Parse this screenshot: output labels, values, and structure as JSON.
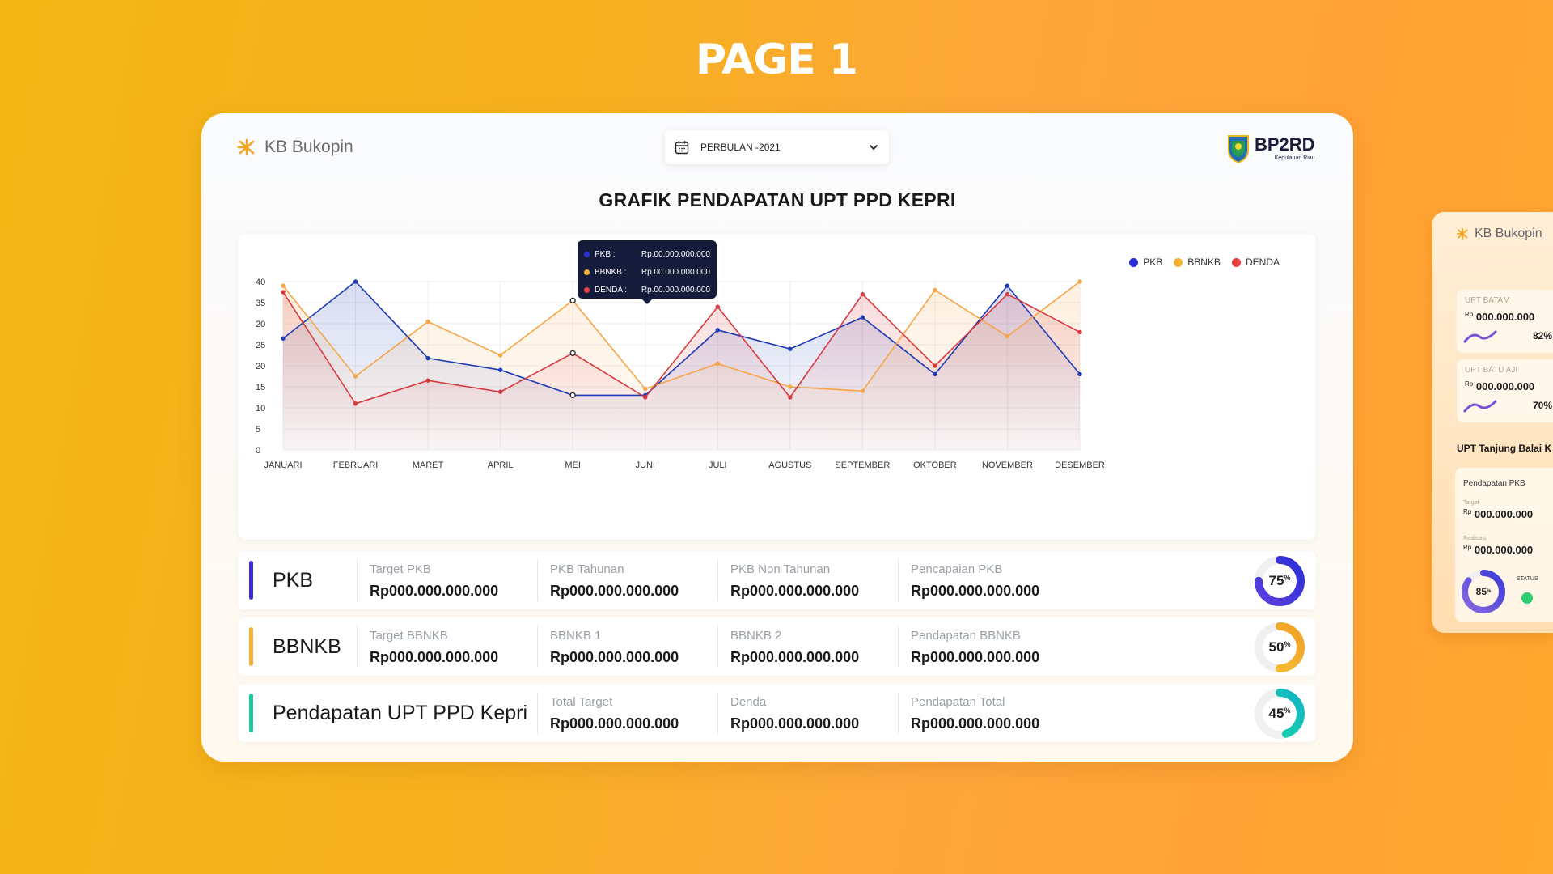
{
  "page": {
    "title": "PAGE 1"
  },
  "brand": {
    "kb_text": "KB Bukopin",
    "bp_text": "BP2RD",
    "bp_sub": "Kepulauan Riau"
  },
  "filter": {
    "period": "PERBULAN -2021"
  },
  "chart_title": "GRAFIK PENDAPATAN UPT PPD KEPRI",
  "legend": [
    {
      "name": "PKB",
      "color": "#2b2fd6"
    },
    {
      "name": "BBNKB",
      "color": "#f2b233"
    },
    {
      "name": "DENDA",
      "color": "#e8403f"
    }
  ],
  "tooltip": {
    "rows": [
      {
        "label": "PKB :",
        "value": "Rp.00.000.000.000",
        "color": "#2b2fd6"
      },
      {
        "label": "BBNKB :",
        "value": "Rp.00.000.000.000",
        "color": "#f2b233"
      },
      {
        "label": "DENDA :",
        "value": "Rp.00.000.000.000",
        "color": "#e8403f"
      }
    ]
  },
  "chart_data": {
    "type": "area",
    "categories": [
      "JANUARI",
      "FEBRUARI",
      "MARET",
      "APRIL",
      "MEI",
      "JUNI",
      "JULI",
      "AGUSTUS",
      "SEPTEMBER",
      "OKTOBER",
      "NOVEMBER",
      "DESEMBER"
    ],
    "y_ticks": [
      "40",
      "35",
      "20",
      "25",
      "20",
      "15",
      "10",
      "5",
      "0"
    ],
    "ylim": [
      0,
      40
    ],
    "grid": true,
    "legend_position": "top-right",
    "series": [
      {
        "name": "PKB",
        "color": "#1c3bb5",
        "values": [
          26.5,
          40,
          21.8,
          19,
          13,
          13,
          28.5,
          24,
          31.5,
          18,
          39,
          18
        ]
      },
      {
        "name": "BBNKB",
        "color": "#f5a547",
        "values": [
          39,
          17.5,
          30.5,
          22.5,
          35.5,
          14.5,
          20.5,
          15,
          14,
          38,
          27,
          40
        ]
      },
      {
        "name": "DENDA",
        "color": "#d9393d",
        "values": [
          37.5,
          11,
          16.5,
          13.8,
          23,
          12.5,
          34,
          12.5,
          37,
          20,
          37,
          28
        ]
      }
    ]
  },
  "stats": [
    {
      "name": "PKB",
      "color": "#3a2fd1",
      "donut_color": "#5b3fe0",
      "donut_color2": "#2b2fd6",
      "percent": 75,
      "cols": [
        {
          "label": "Target PKB",
          "value": "Rp000.000.000.000"
        },
        {
          "label": "PKB Tahunan",
          "value": "Rp000.000.000.000"
        },
        {
          "label": "PKB Non Tahunan",
          "value": "Rp000.000.000.000"
        },
        {
          "label": "Pencapaian PKB",
          "value": "Rp000.000.000.000"
        }
      ]
    },
    {
      "name": "BBNKB",
      "color": "#f2b233",
      "donut_color": "#f5c531",
      "donut_color2": "#f29f2a",
      "percent": 50,
      "cols": [
        {
          "label": "Target BBNKB",
          "value": "Rp000.000.000.000"
        },
        {
          "label": "BBNKB 1",
          "value": "Rp000.000.000.000"
        },
        {
          "label": "BBNKB 2",
          "value": "Rp000.000.000.000"
        },
        {
          "label": "Pendapatan BBNKB",
          "value": "Rp000.000.000.000"
        }
      ]
    },
    {
      "name": "Pendapatan UPT PPD Kepri",
      "color": "#1ec9a0",
      "donut_color": "#1ed6a4",
      "donut_color2": "#12b5c4",
      "percent": 45,
      "cols": [
        {
          "label": "Total Target",
          "value": "Rp000.000.000.000"
        },
        {
          "label": "Denda",
          "value": "Rp000.000.000.000"
        },
        {
          "label": "Pendapatan Total",
          "value": "Rp000.000.000.000"
        }
      ]
    }
  ],
  "side": {
    "logo": "KB Bukopin",
    "minis": [
      {
        "title": "UPT BATAM",
        "rp": "Rp",
        "amount": "000.000.000",
        "percent": "82%"
      },
      {
        "title": "UPT BATU AJI",
        "rp": "Rp",
        "amount": "000.000.000",
        "percent": "70%"
      }
    ],
    "section": "UPT Tanjung Balai K",
    "box": {
      "heading": "Pendapatan PKB",
      "target_label": "Target",
      "target_rp": "Rp",
      "target_value": "000.000.000",
      "real_label": "Realisasi",
      "real_rp": "Rp",
      "real_value": "000.000.000",
      "percent": 85,
      "status_label": "STATUS"
    }
  }
}
